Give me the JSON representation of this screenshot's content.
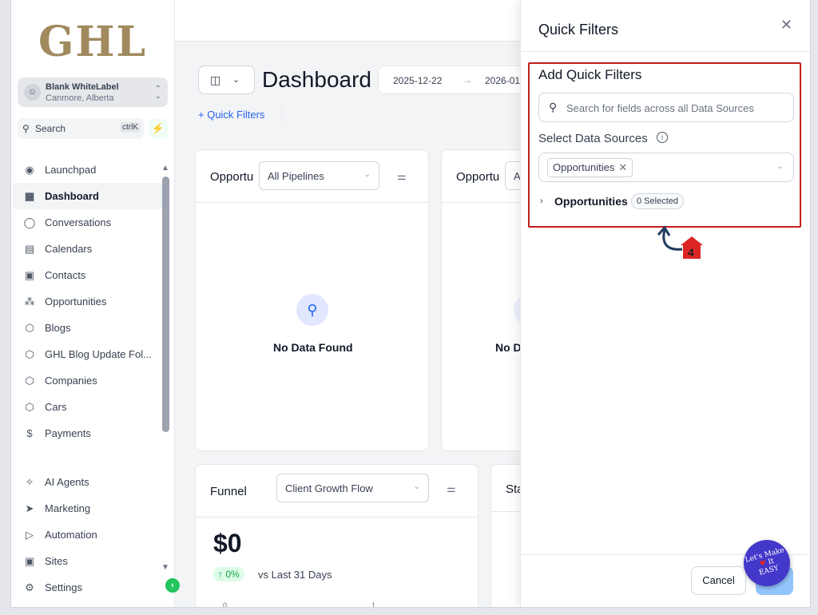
{
  "sidebar": {
    "logo": "GHL",
    "account_name": "Blank WhiteLabel",
    "account_location": "Canmore, Alberta",
    "search_label": "Search",
    "search_shortcut": "ctrlK",
    "items": [
      {
        "label": "Launchpad",
        "icon": "launchpad-icon",
        "glyph": "◉"
      },
      {
        "label": "Dashboard",
        "icon": "dashboard-icon",
        "glyph": "▦"
      },
      {
        "label": "Conversations",
        "icon": "chat-icon",
        "glyph": "◯"
      },
      {
        "label": "Calendars",
        "icon": "calendar-icon",
        "glyph": "▤"
      },
      {
        "label": "Contacts",
        "icon": "contacts-icon",
        "glyph": "▣"
      },
      {
        "label": "Opportunities",
        "icon": "opportunities-icon",
        "glyph": "⁂"
      },
      {
        "label": "Blogs",
        "icon": "cube-icon",
        "glyph": "⬡"
      },
      {
        "label": "GHL Blog Update Fol...",
        "icon": "cube-icon",
        "glyph": "⬡"
      },
      {
        "label": "Companies",
        "icon": "cube-icon",
        "glyph": "⬡"
      },
      {
        "label": "Cars",
        "icon": "cube-icon",
        "glyph": "⬡"
      },
      {
        "label": "Payments",
        "icon": "payments-icon",
        "glyph": "$"
      }
    ],
    "items2": [
      {
        "label": "AI Agents",
        "icon": "sparkle-icon",
        "glyph": "✧"
      },
      {
        "label": "Marketing",
        "icon": "send-icon",
        "glyph": "➤"
      },
      {
        "label": "Automation",
        "icon": "automation-icon",
        "glyph": "▷"
      },
      {
        "label": "Sites",
        "icon": "sites-icon",
        "glyph": "▣"
      },
      {
        "label": "Settings",
        "icon": "gear-icon",
        "glyph": "⚙"
      }
    ]
  },
  "header": {
    "title": "Dashboard",
    "date_start": "2025-12-22",
    "date_end": "2026-01",
    "quick_filters_link": "+ Quick Filters"
  },
  "cards": {
    "opp1": {
      "title": "Opportu",
      "select": "All Pipelines",
      "empty": "No Data Found"
    },
    "opp2": {
      "title": "Opportu",
      "select": "A",
      "empty": "No D"
    },
    "funnel": {
      "title": "Funnel",
      "select": "Client Growth Flow",
      "value": "$0",
      "change": "↑ 0%",
      "compare": "vs Last 31 Days",
      "axis_0": "0",
      "axis_1": "1"
    },
    "stage": {
      "title": "Sta"
    }
  },
  "drawer": {
    "title": "Quick Filters",
    "section_title": "Add Quick Filters",
    "search_placeholder": "Search for fields across all Data Sources",
    "data_sources_label": "Select Data Sources",
    "selected_source": "Opportunities",
    "group_label": "Opportunities",
    "group_badge": "0 Selected",
    "annotation_number": "4",
    "cancel_label": "Cancel"
  },
  "watermark": {
    "line1": "Let's Make",
    "line2": "It",
    "line3": "EASY"
  },
  "colors": {
    "accent": "#2563eb",
    "highlight": "#c11d1d",
    "success": "#16a34a"
  }
}
